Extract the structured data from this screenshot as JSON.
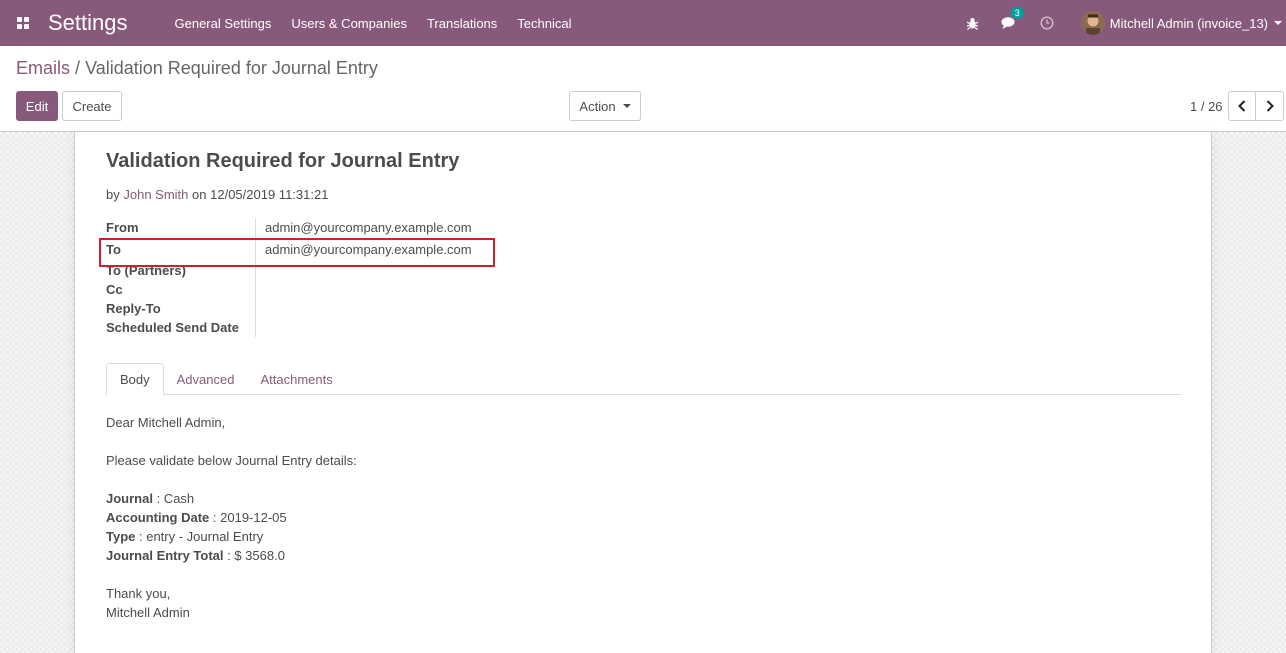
{
  "navbar": {
    "brand": "Settings",
    "menu": [
      "General Settings",
      "Users & Companies",
      "Translations",
      "Technical"
    ],
    "chat_count": "3",
    "user": "Mitchell Admin (invoice_13)"
  },
  "breadcrumb": {
    "parent": "Emails",
    "separator": "/",
    "current": "Validation Required for Journal Entry"
  },
  "buttons": {
    "edit": "Edit",
    "create": "Create",
    "action": "Action"
  },
  "pager": {
    "value": "1 / 26"
  },
  "record": {
    "title": "Validation Required for Journal Entry",
    "by_prefix": "by",
    "author": "John Smith",
    "date_prefix": "on",
    "date": "12/05/2019 11:31:21",
    "fields": {
      "from_label": "From",
      "from_value": "admin@yourcompany.example.com",
      "to_label": "To",
      "to_value": "admin@yourcompany.example.com",
      "to_partners_label": "To (Partners)",
      "cc_label": "Cc",
      "reply_to_label": "Reply-To",
      "scheduled_label": "Scheduled Send Date"
    },
    "tabs": [
      "Body",
      "Advanced",
      "Attachments"
    ],
    "body": {
      "greeting": "Dear Mitchell Admin,",
      "intro": "Please validate below Journal Entry details:",
      "journal_label": "Journal",
      "journal_value": " : Cash",
      "date_label": "Accounting Date",
      "date_value": " : 2019-12-05",
      "type_label": "Type",
      "type_value": " : entry - Journal Entry",
      "total_label": "Journal Entry Total",
      "total_value": " : $ 3568.0",
      "thanks": "Thank you,",
      "signature": "Mitchell Admin"
    }
  },
  "colors": {
    "brand": "#875a7b",
    "highlight": "#d0202e",
    "badge": "#00a09d"
  },
  "icons": [
    "apps-icon",
    "bug-icon",
    "chat-icon",
    "clock-icon",
    "chevron-left-icon",
    "chevron-right-icon"
  ]
}
